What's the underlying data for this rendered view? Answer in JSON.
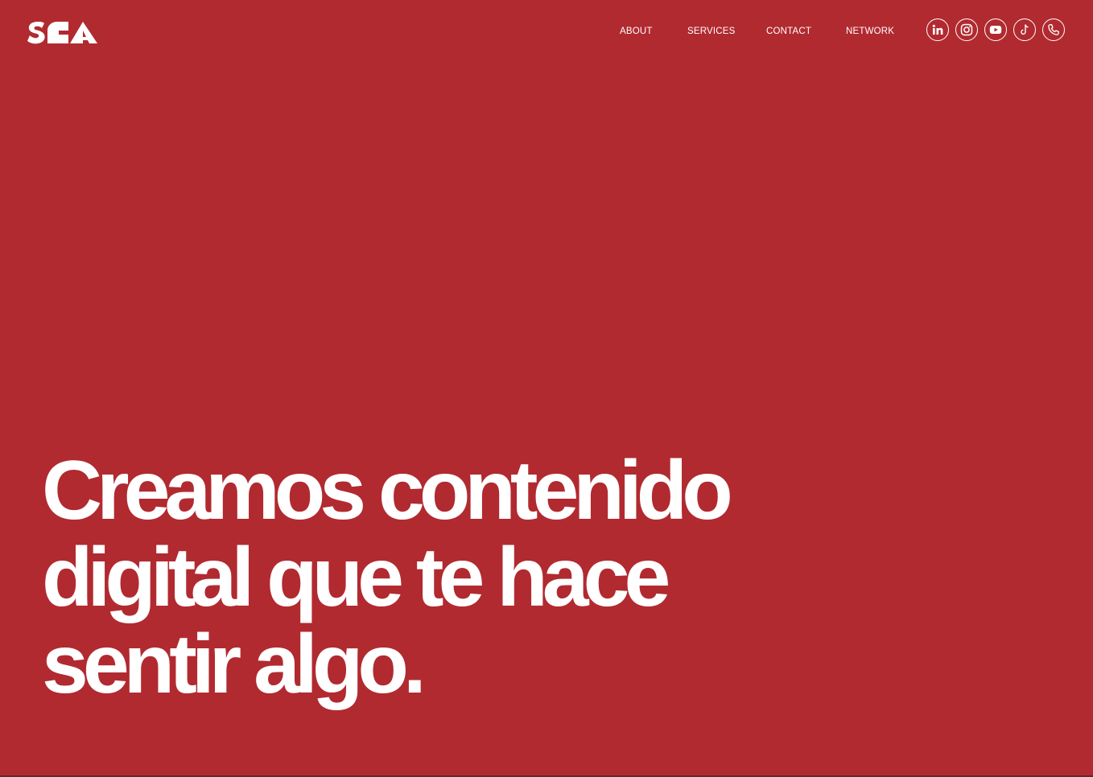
{
  "colors": {
    "background": "#b12a30",
    "foreground": "#ffffff"
  },
  "brand": {
    "logo_text": "SCA",
    "logo_icon": "sca-logo-icon"
  },
  "nav": {
    "items": [
      {
        "label": "ABOUT"
      },
      {
        "label": "SERVICES"
      },
      {
        "label": "CONTACT"
      },
      {
        "label": "NETWORK"
      }
    ]
  },
  "social": [
    {
      "icon": "linkedin-icon"
    },
    {
      "icon": "instagram-icon"
    },
    {
      "icon": "youtube-icon"
    },
    {
      "icon": "tiktok-icon"
    },
    {
      "icon": "phone-icon"
    }
  ],
  "hero": {
    "line1": "Creamos contenido",
    "line2": "digital que te hace",
    "line3": "sentir algo."
  }
}
